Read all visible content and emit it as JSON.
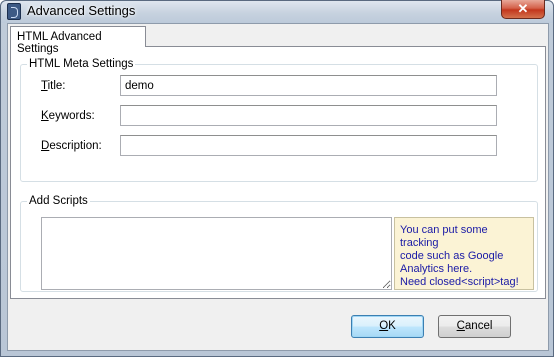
{
  "window": {
    "title": "Advanced Settings",
    "close_symbol": "✕"
  },
  "tabs": [
    {
      "label": "HTML Advanced Settings",
      "active": true
    }
  ],
  "meta_settings": {
    "group_label": "HTML Meta Settings",
    "title": {
      "label_key": "T",
      "label_rest": "itle:",
      "value": "demo"
    },
    "keywords": {
      "label_key": "K",
      "label_rest": "eywords:",
      "value": ""
    },
    "description": {
      "label_key": "D",
      "label_rest": "escription:",
      "value": ""
    }
  },
  "scripts": {
    "group_label": "Add Scripts",
    "value": "",
    "tip_lines": [
      "You can put some tracking",
      "code such as Google",
      "Analytics here.",
      "Need closed<script>tag!"
    ]
  },
  "buttons": {
    "ok": {
      "key": "O",
      "rest": "K"
    },
    "cancel": {
      "key": "C",
      "rest": "ancel"
    }
  },
  "colors": {
    "tip_text": "#1a1aa6",
    "tip_background": "#fbf3d5",
    "default_button_border": "#3c7fb1"
  }
}
